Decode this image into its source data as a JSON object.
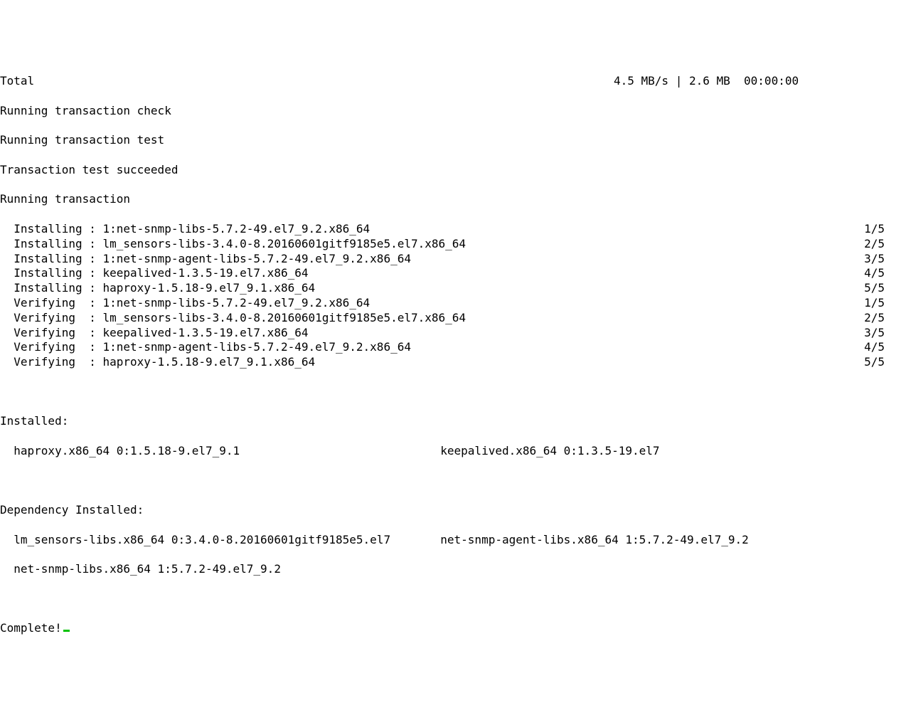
{
  "total": {
    "label": "Total",
    "speed": "4.5 MB/s",
    "size": "2.6 MB",
    "time": "00:00:00"
  },
  "status": {
    "check": "Running transaction check",
    "test": "Running transaction test",
    "succeeded": "Transaction test succeeded",
    "running": "Running transaction"
  },
  "actions": [
    {
      "label": "Installing",
      "pkg": "1:net-snmp-libs-5.7.2-49.el7_9.2.x86_64",
      "progress": "1/5"
    },
    {
      "label": "Installing",
      "pkg": "lm_sensors-libs-3.4.0-8.20160601gitf9185e5.el7.x86_64",
      "progress": "2/5"
    },
    {
      "label": "Installing",
      "pkg": "1:net-snmp-agent-libs-5.7.2-49.el7_9.2.x86_64",
      "progress": "3/5"
    },
    {
      "label": "Installing",
      "pkg": "keepalived-1.3.5-19.el7.x86_64",
      "progress": "4/5"
    },
    {
      "label": "Installing",
      "pkg": "haproxy-1.5.18-9.el7_9.1.x86_64",
      "progress": "5/5"
    },
    {
      "label": "Verifying ",
      "pkg": "1:net-snmp-libs-5.7.2-49.el7_9.2.x86_64",
      "progress": "1/5"
    },
    {
      "label": "Verifying ",
      "pkg": "lm_sensors-libs-3.4.0-8.20160601gitf9185e5.el7.x86_64",
      "progress": "2/5"
    },
    {
      "label": "Verifying ",
      "pkg": "keepalived-1.3.5-19.el7.x86_64",
      "progress": "3/5"
    },
    {
      "label": "Verifying ",
      "pkg": "1:net-snmp-agent-libs-5.7.2-49.el7_9.2.x86_64",
      "progress": "4/5"
    },
    {
      "label": "Verifying ",
      "pkg": "haproxy-1.5.18-9.el7_9.1.x86_64",
      "progress": "5/5"
    }
  ],
  "installed": {
    "header": "Installed:",
    "items": [
      "haproxy.x86_64 0:1.5.18-9.el7_9.1",
      "keepalived.x86_64 0:1.3.5-19.el7"
    ]
  },
  "depinstalled": {
    "header": "Dependency Installed:",
    "items": [
      "lm_sensors-libs.x86_64 0:3.4.0-8.20160601gitf9185e5.el7",
      "net-snmp-agent-libs.x86_64 1:5.7.2-49.el7_9.2",
      "net-snmp-libs.x86_64 1:5.7.2-49.el7_9.2"
    ]
  },
  "complete": "Complete!"
}
